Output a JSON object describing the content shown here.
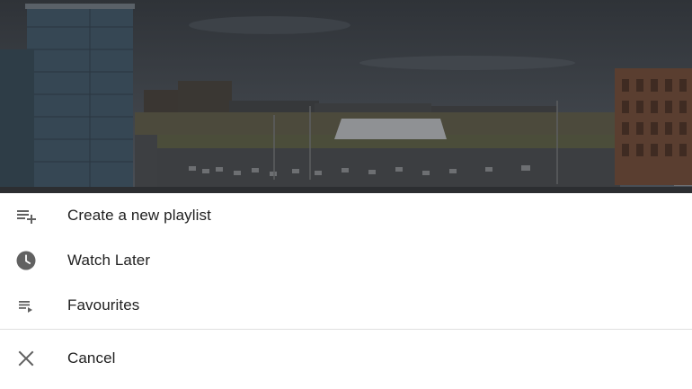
{
  "menu": {
    "items": [
      {
        "label": "Create a new playlist",
        "icon": "playlist-add-icon"
      },
      {
        "label": "Watch Later",
        "icon": "clock-icon"
      },
      {
        "label": "Favourites",
        "icon": "playlist-play-icon"
      }
    ],
    "cancel": {
      "label": "Cancel",
      "icon": "close-icon"
    }
  },
  "colors": {
    "icon": "#616161",
    "text": "#212121",
    "divider": "#e0e0e0"
  }
}
